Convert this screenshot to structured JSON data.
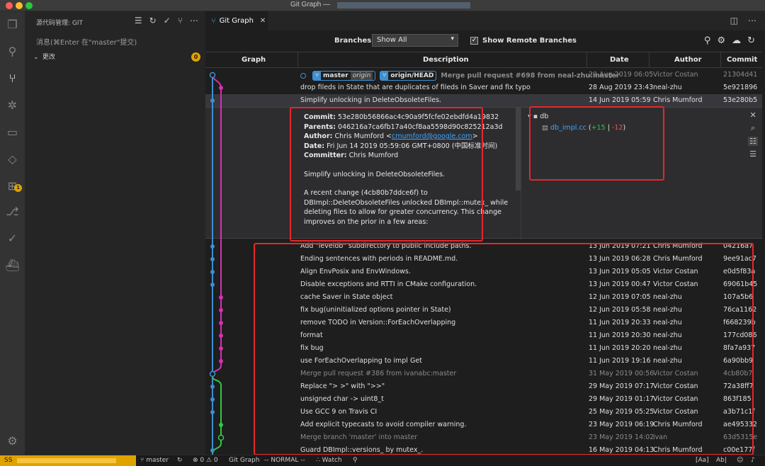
{
  "window": {
    "title": "Git Graph —"
  },
  "sidebar": {
    "header": "源代码管理: GIT",
    "message_placeholder": "消息(⌘Enter 在\"master\"提交)",
    "changes_label": "更改",
    "changes_count": "0"
  },
  "activity_bar": {
    "icons": [
      "files-icon",
      "search-icon",
      "source-control-icon",
      "debug-icon",
      "remote-icon",
      "extensions-icon",
      "extensions-badge-icon",
      "git-graph-icon",
      "check-icon",
      "docker-icon",
      "settings-gear-icon"
    ],
    "extensions_badge": "1"
  },
  "tab": {
    "label": "Git Graph",
    "close": "✕"
  },
  "controls": {
    "branches_label": "Branches:",
    "branches_value": "Show All",
    "show_remote_label": "Show Remote Branches",
    "show_remote_checked": true
  },
  "table": {
    "headers": {
      "graph": "Graph",
      "description": "Description",
      "date": "Date",
      "author": "Author",
      "commit": "Commit"
    },
    "head_row": {
      "refs": [
        {
          "name": "master",
          "remote": "origin"
        },
        {
          "name": "origin/HEAD"
        }
      ],
      "description": "Merge pull request #698 from neal-zhu:master",
      "date": "29 Aug 2019 06:05",
      "author": "Victor Costan",
      "commit": "21304d41"
    },
    "rows_top": [
      {
        "description": "drop fileds in State that are duplicates of fileds in Saver and fix typo",
        "date": "28 Aug 2019 23:43",
        "author": "neal-zhu",
        "commit": "5e921896",
        "merge": false
      },
      {
        "description": "Simplify unlocking in DeleteObsoleteFiles.",
        "date": "14 Jun 2019 05:59",
        "author": "Chris Mumford",
        "commit": "53e280b5",
        "merge": false
      }
    ],
    "rows_bottom": [
      {
        "description": "Add \"leveldb\" subdirectory to public include paths.",
        "date": "13 Jun 2019 07:21",
        "author": "Chris Mumford",
        "commit": "04216a7",
        "merge": false
      },
      {
        "description": "Ending sentences with periods in README.md.",
        "date": "13 Jun 2019 06:28",
        "author": "Chris Mumford",
        "commit": "9ee91ac7",
        "merge": false
      },
      {
        "description": "Align EnvPosix and EnvWindows.",
        "date": "13 Jun 2019 05:05",
        "author": "Victor Costan",
        "commit": "e0d5f83a",
        "merge": false
      },
      {
        "description": "Disable exceptions and RTTI in CMake configuration.",
        "date": "13 Jun 2019 00:47",
        "author": "Victor Costan",
        "commit": "69061b45",
        "merge": false
      },
      {
        "description": "cache Saver in State object",
        "date": "12 Jun 2019 07:05",
        "author": "neal-zhu",
        "commit": "107a5b6",
        "merge": false
      },
      {
        "description": "fix bug(uninitialized options pointer in State)",
        "date": "12 Jun 2019 05:58",
        "author": "neal-zhu",
        "commit": "76ca1162",
        "merge": false
      },
      {
        "description": "remove TODO in Version::ForEachOverlapping",
        "date": "11 Jun 2019 20:33",
        "author": "neal-zhu",
        "commit": "f668239b",
        "merge": false
      },
      {
        "description": "format",
        "date": "11 Jun 2019 20:30",
        "author": "neal-zhu",
        "commit": "177cd086",
        "merge": false
      },
      {
        "description": "fix bug",
        "date": "11 Jun 2019 20:20",
        "author": "neal-zhu",
        "commit": "8fa7a937",
        "merge": false
      },
      {
        "description": "use ForEachOverlapping to impl Get",
        "date": "11 Jun 2019 19:16",
        "author": "neal-zhu",
        "commit": "6a90bb9",
        "merge": false
      },
      {
        "description": "Merge pull request #386 from ivanabc:master",
        "date": "31 May 2019 00:56",
        "author": "Victor Costan",
        "commit": "4cb80b7",
        "merge": true
      },
      {
        "description": "Replace \"> >\" with \">>\"",
        "date": "29 May 2019 07:17",
        "author": "Victor Costan",
        "commit": "72a38ff7",
        "merge": false
      },
      {
        "description": "unsigned char -> uint8_t",
        "date": "29 May 2019 01:17",
        "author": "Victor Costan",
        "commit": "863f185",
        "merge": false
      },
      {
        "description": "Use GCC 9 on Travis CI",
        "date": "25 May 2019 05:25",
        "author": "Victor Costan",
        "commit": "a3b71c1f",
        "merge": false
      },
      {
        "description": "Add explicit typecasts to avoid compiler warning.",
        "date": "23 May 2019 06:19",
        "author": "Chris Mumford",
        "commit": "ae495332",
        "merge": false
      },
      {
        "description": "Merge branch 'master' into master",
        "date": "23 May 2019 14:02",
        "author": "ivan",
        "commit": "63d5315e",
        "merge": true
      },
      {
        "description": "Guard DBImpl::versions_ by mutex_.",
        "date": "16 May 2019 04:13",
        "author": "Chris Mumford",
        "commit": "c00e177f",
        "merge": false
      }
    ]
  },
  "details": {
    "commit_label": "Commit:",
    "commit_value": "53e280b56866ac4c90a9f5fcfe02ebdfd4a19832",
    "parents_label": "Parents:",
    "parents_value": "046216a7ca6fb17a40cf8aa5598d90c825212a3d",
    "author_label": "Author:",
    "author_name": "Chris Mumford <",
    "author_email": "cmumford@google.com",
    "author_end": ">",
    "date_label": "Date:",
    "date_value": "Fri Jun 14 2019 05:59:06 GMT+0800 (中国标准时间)",
    "committer_label": "Committer:",
    "committer_value": "Chris Mumford",
    "summary": "Simplify unlocking in DeleteObsoleteFiles.",
    "body": "A recent change (4cb80b7ddce6f) to DBImpl::DeleteObsoleteFiles unlocked DBImpl::mutex_ while deleting files to allow for greater concurrency. This change improves on the prior in a few areas:",
    "folder": "db",
    "file": "db_impl.cc",
    "additions": "+15",
    "sep": "|",
    "deletions": "-12"
  },
  "statusbar": {
    "remote": "SS",
    "branch": "master",
    "problems": "⊗ 0 ⚠ 0",
    "git_graph": "Git Graph",
    "vim_mode": "-- NORMAL --",
    "watch": "Watch",
    "right_aa": "[Aa]",
    "right_ab": "Ab|"
  },
  "colors": {
    "accent": "#3e8ed0",
    "branch_pink": "#d62fb2",
    "branch_green": "#2ecc40",
    "annotation": "#e8262a"
  }
}
